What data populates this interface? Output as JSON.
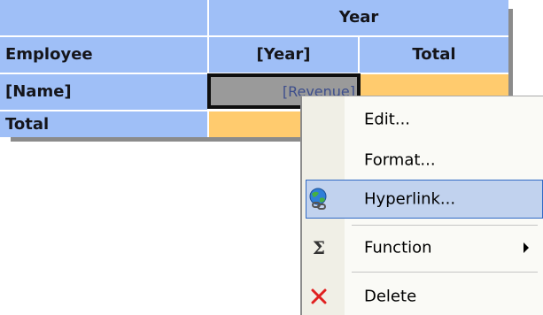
{
  "pivot": {
    "column_group_header": "Year",
    "row_field_header": "Employee",
    "column_field_header": "[Year]",
    "column_total_header": "Total",
    "row_field_value": "[Name]",
    "data_field_value": "[Revenue]",
    "row_total_header": "Total"
  },
  "context_menu": {
    "items": [
      {
        "label": "Edit...",
        "icon": ""
      },
      {
        "label": "Format...",
        "icon": ""
      },
      {
        "label": "Hyperlink...",
        "icon": "globe-link-icon",
        "highlighted": true
      },
      {
        "label": "Function",
        "icon": "sigma-icon",
        "submenu": true
      },
      {
        "label": "Delete",
        "icon": "red-x-icon"
      }
    ]
  },
  "colors": {
    "header_blue": "#9fbff7",
    "total_orange": "#ffcb6e",
    "selected_cell_gray": "#9a9a9a",
    "menu_highlight": "#c1d2ee",
    "menu_highlight_border": "#316ac5"
  }
}
